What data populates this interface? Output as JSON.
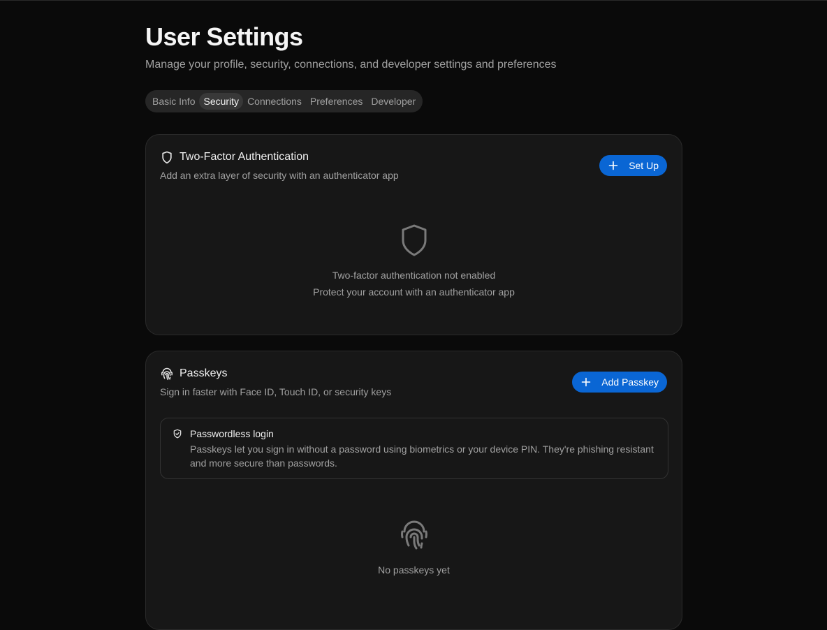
{
  "page": {
    "title": "User Settings",
    "subtitle": "Manage your profile, security, connections, and developer settings and preferences"
  },
  "tabs": [
    {
      "label": "Basic Info",
      "active": false
    },
    {
      "label": "Security",
      "active": true
    },
    {
      "label": "Connections",
      "active": false
    },
    {
      "label": "Preferences",
      "active": false
    },
    {
      "label": "Developer",
      "active": false
    }
  ],
  "two_factor": {
    "icon": "shield-icon",
    "title": "Two-Factor Authentication",
    "description": "Add an extra layer of security with an authenticator app",
    "button_label": "Set Up",
    "empty_title": "Two-factor authentication not enabled",
    "empty_subtitle": "Protect your account with an authenticator app"
  },
  "passkeys": {
    "icon": "fingerprint-icon",
    "title": "Passkeys",
    "description": "Sign in faster with Face ID, Touch ID, or security keys",
    "button_label": "Add Passkey",
    "info_title": "Passwordless login",
    "info_body": "Passkeys let you sign in without a password using biometrics or your device PIN. They're phishing resistant and more secure than passwords.",
    "empty_title": "No passkeys yet"
  },
  "colors": {
    "background": "#0a0a0a",
    "card": "#171717",
    "accent": "#0a66d4"
  }
}
